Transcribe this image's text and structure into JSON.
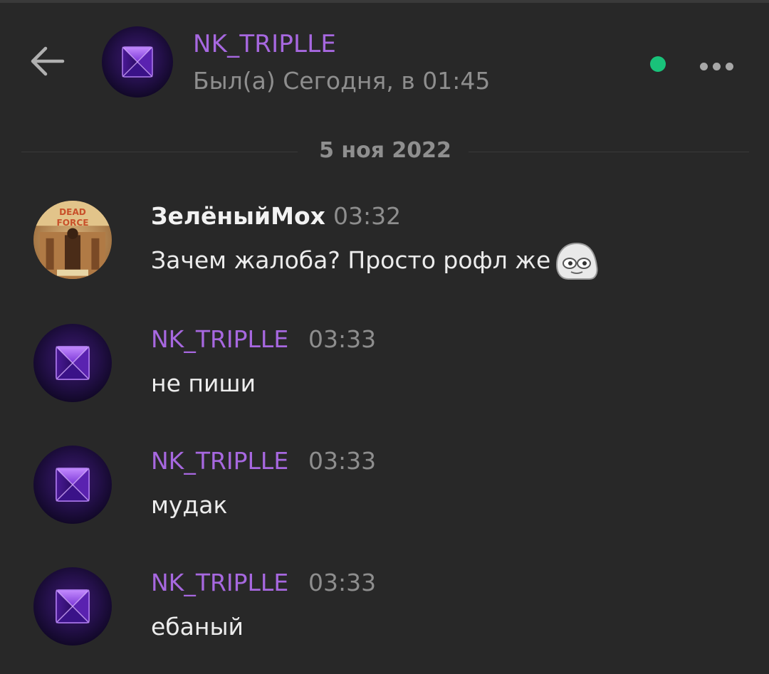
{
  "header": {
    "title": "NK_TRIPLLE",
    "status": "Был(а) Сегодня, в 01:45",
    "online_color": "#19c27a",
    "back_icon": "arrow-left-icon",
    "more_icon": "more-horizontal-icon"
  },
  "date_separator": "5 ноя 2022",
  "colors": {
    "background": "#282828",
    "accent": "#a768e0",
    "muted": "#8e8e8e"
  },
  "messages": [
    {
      "author": "ЗелёныйМох",
      "time": "03:32",
      "text": "Зачем жалоба? Просто рофл же",
      "emoji": "meme-face-emoji"
    },
    {
      "author": "NK_TRIPLLE",
      "time": "03:33",
      "text": "не пиши"
    },
    {
      "author": "NK_TRIPLLE",
      "time": "03:33",
      "text": "мудак"
    },
    {
      "author": "NK_TRIPLLE",
      "time": "03:33",
      "text": "ебаный"
    }
  ]
}
